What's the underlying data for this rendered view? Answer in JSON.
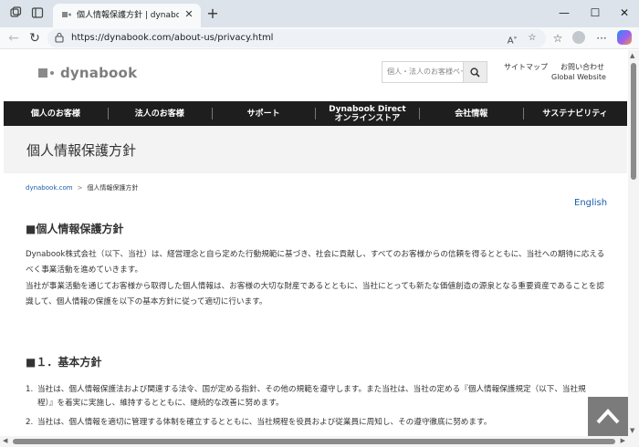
{
  "browser": {
    "tab_title": "個人情報保護方針 | dynabook（ダイナブック）",
    "url": "https://dynabook.com/about-us/privacy.html"
  },
  "site": {
    "logo_text": "dynabook",
    "search_placeholder": "個人・法人のお客様ページ内を検索",
    "sitemap": "サイトマップ",
    "contact": "お問い合わせ",
    "global": "Global Website"
  },
  "nav": {
    "items": [
      {
        "label": "個人のお客様"
      },
      {
        "label": "法人のお客様"
      },
      {
        "label": "サポート"
      },
      {
        "label": "Dynabook Direct\nオンラインストア"
      },
      {
        "label": "会社情報"
      },
      {
        "label": "サステナビリティ"
      }
    ]
  },
  "page": {
    "title": "個人情報保護方針",
    "breadcrumb_home": "dynabook.com",
    "breadcrumb_sep": ">",
    "breadcrumb_current": "個人情報保護方針",
    "english_link": "English",
    "section1_heading": "■個人情報保護方針",
    "intro_p1": "Dynabook株式会社（以下、当社）は、経営理念と自ら定めた行動規範に基づき、社会に貢献し、すべてのお客様からの信頼を得るとともに、当社への期待に応えるべく事業活動を進めていきます。",
    "intro_p2": "当社が事業活動を通じてお客様から取得した個人情報は、お客様の大切な財産であるとともに、当社にとっても新たな価値創造の源泉となる重要資産であることを認識して、個人情報の保護を以下の基本方針に従って適切に行います。",
    "section2_heading": "■１．基本方針",
    "list": [
      {
        "num": "1.",
        "text": "当社は、個人情報保護法および関連する法令、国が定める指針、その他の規範を遵守します。また当社は、当社の定める『個人情報保護規定（以下、当社規程）』を着実に実施し、維持するとともに、継続的な改善に努めます。"
      },
      {
        "num": "2.",
        "text": "当社は、個人情報を適切に管理する体制を確立するとともに、当社規程を役員および従業員に周知し、その遵守徹底に努めます。"
      }
    ]
  }
}
